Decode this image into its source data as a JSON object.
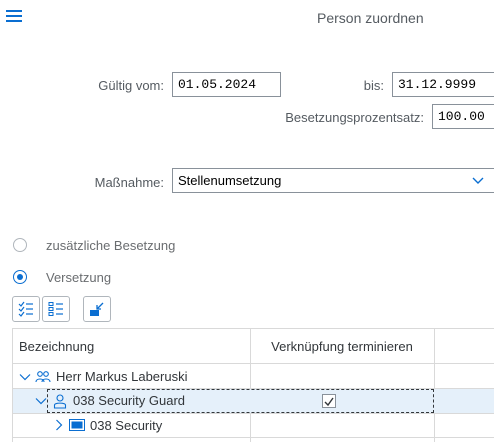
{
  "header": {
    "title": "Person zuordnen",
    "menu_icon": "hamburger-menu-icon"
  },
  "form": {
    "valid_from_label": "Gültig vom:",
    "valid_from_value": "01.05.2024",
    "valid_to_label": "bis:",
    "valid_to_value": "31.12.9999",
    "staffing_pct_label": "Besetzungsprozentsatz:",
    "staffing_pct_value": "100.00",
    "action_label": "Maßnahme:",
    "action_value": "Stellenumsetzung"
  },
  "options": {
    "additional_staffing": "zusätzliche Besetzung",
    "transfer": "Versetzung",
    "selected": "Versetzung"
  },
  "toolbar": {
    "icons": [
      "select-all-icon",
      "deselect-all-icon",
      "collapse-icon"
    ]
  },
  "table": {
    "columns": [
      "Bezeichnung",
      "Verknüpfung terminieren"
    ],
    "rows": [
      {
        "label": "Herr Markus Laberuski",
        "icon": "person-group-icon",
        "expanded": true,
        "checked": false
      },
      {
        "label": "038 Security Guard",
        "icon": "person-icon",
        "expanded": true,
        "checked": true,
        "selected": true
      },
      {
        "label": "038 Security",
        "icon": "org-unit-icon",
        "expanded": false,
        "checked": false
      }
    ]
  },
  "colors": {
    "accent": "#0a6ed1",
    "selection": "#e5f0fa"
  }
}
